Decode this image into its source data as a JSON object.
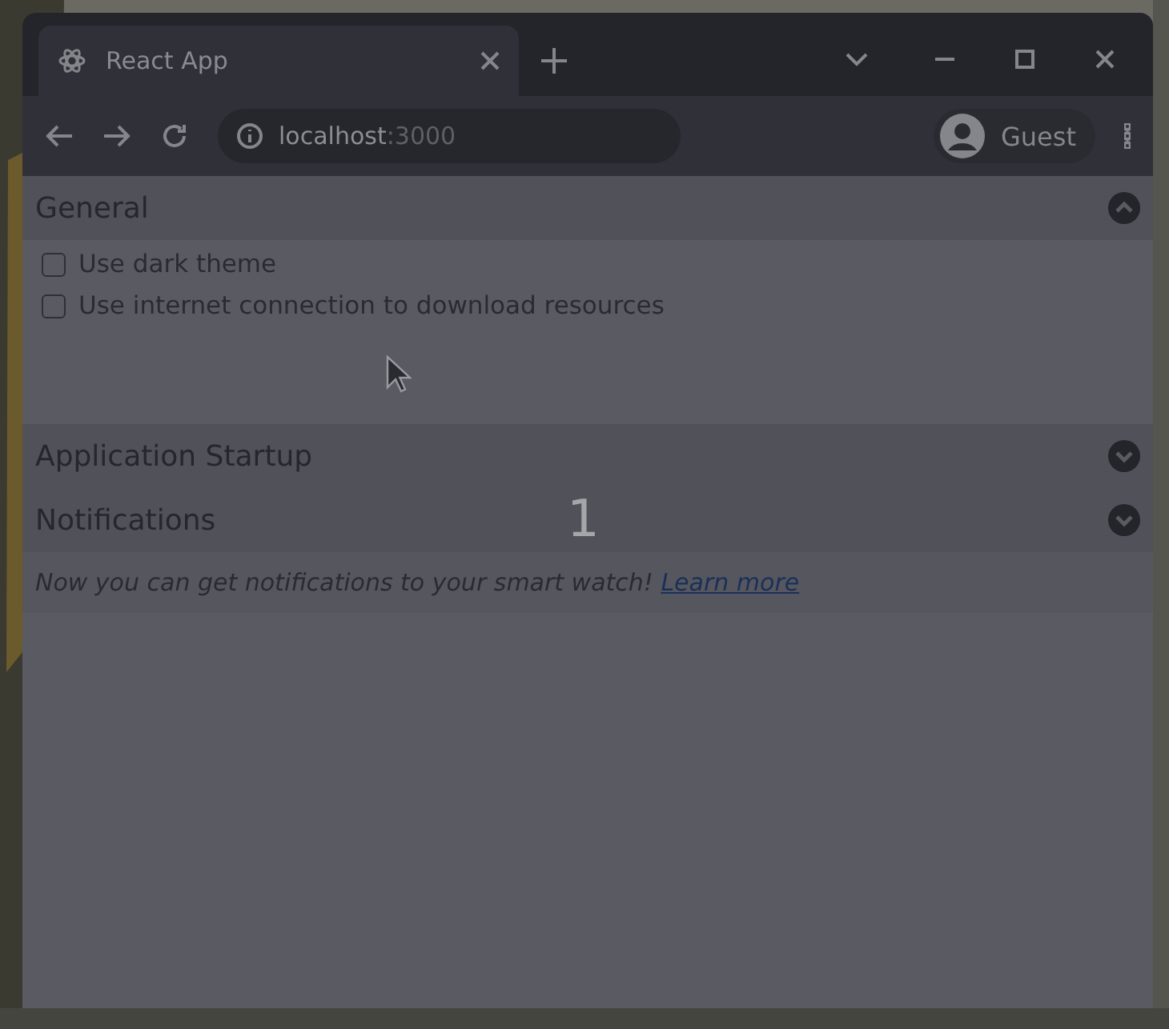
{
  "browser": {
    "tabs": [
      {
        "title": "React App",
        "selected": true
      }
    ],
    "address": {
      "host": "localhost",
      "port": ":3000"
    },
    "profile": "Guest"
  },
  "sections": [
    {
      "title": "General",
      "expanded": true,
      "options": [
        {
          "label": "Use dark theme",
          "checked": false
        },
        {
          "label": "Use internet connection to download resources",
          "checked": false
        }
      ]
    },
    {
      "title": "Application Startup",
      "expanded": false
    },
    {
      "title": "Notifications",
      "expanded": false
    }
  ],
  "notice": {
    "text": "Now you can get notifications to your smart watch!",
    "link": "Learn more"
  },
  "step_number": "1"
}
